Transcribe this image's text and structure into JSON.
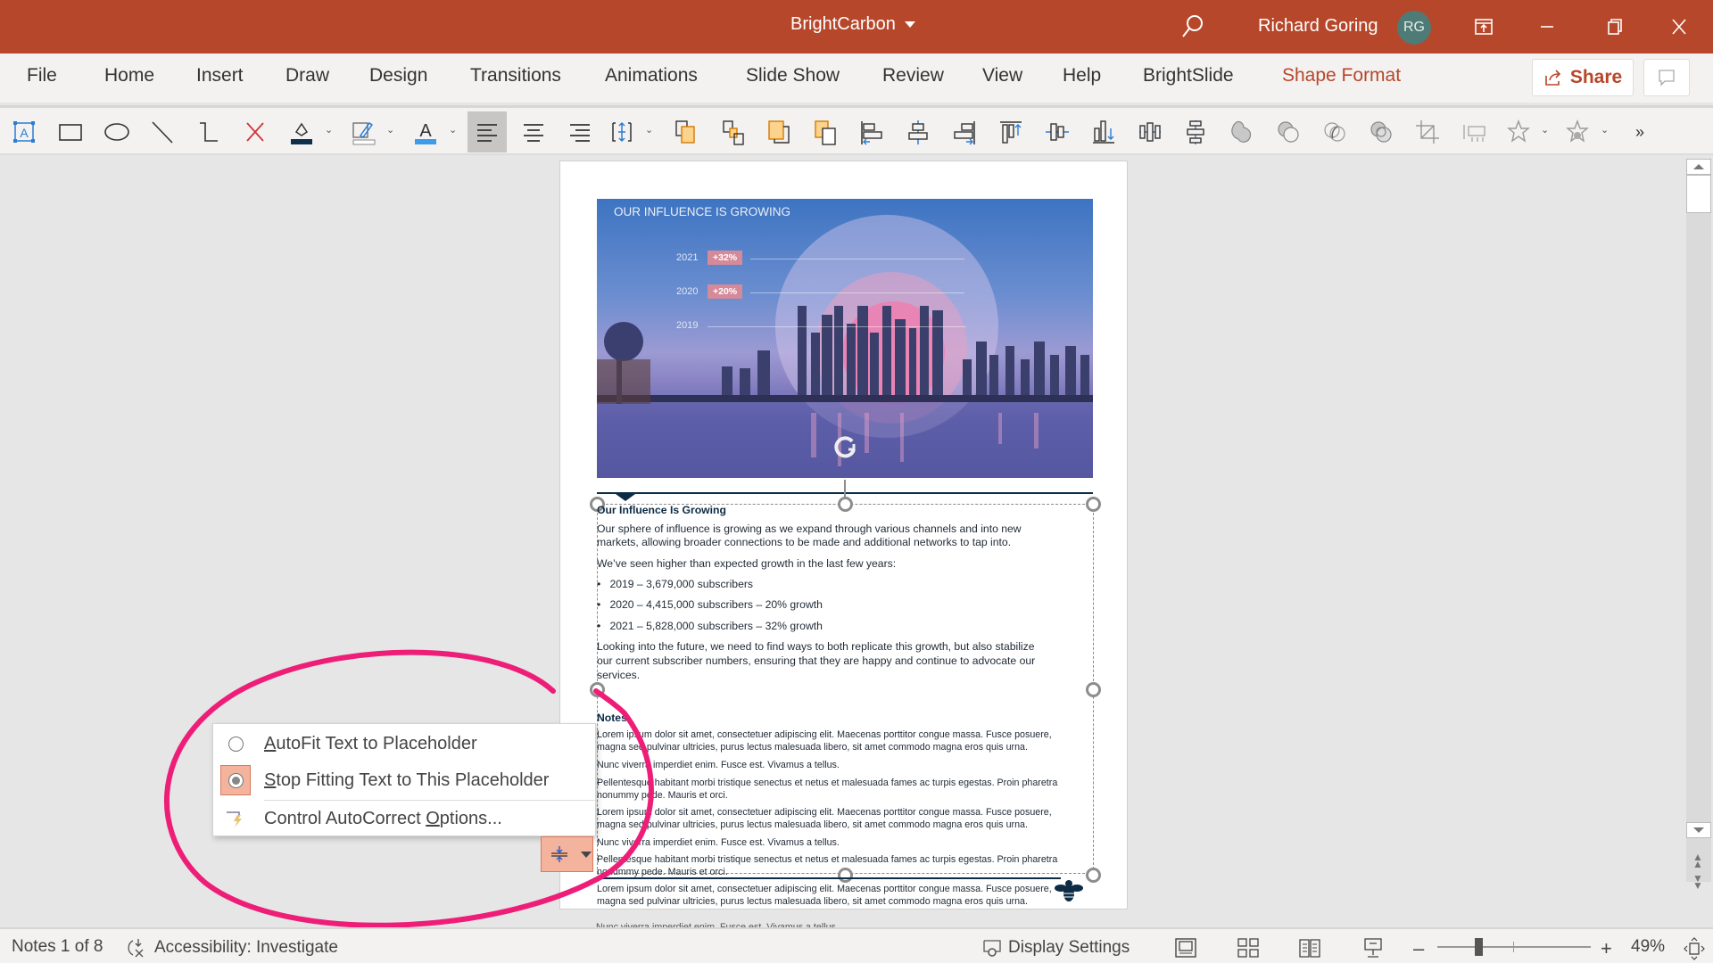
{
  "titlebar": {
    "doc_title": "BrightCarbon",
    "user_name": "Richard Goring",
    "avatar_initials": "RG",
    "brand_color": "#b7472a"
  },
  "ribbon": {
    "tabs": [
      {
        "label": "File"
      },
      {
        "label": "Home"
      },
      {
        "label": "Insert"
      },
      {
        "label": "Draw"
      },
      {
        "label": "Design"
      },
      {
        "label": "Transitions"
      },
      {
        "label": "Animations"
      },
      {
        "label": "Slide Show"
      },
      {
        "label": "Review"
      },
      {
        "label": "View"
      },
      {
        "label": "Help"
      },
      {
        "label": "BrightSlide"
      },
      {
        "label": "Shape Format",
        "active": true
      }
    ],
    "share_label": "Share"
  },
  "toolbar": {
    "icons": [
      "text-box-icon",
      "rectangle-icon",
      "oval-icon",
      "line-icon",
      "elbow-connector-icon",
      "delete-icon",
      "shape-fill-icon",
      "shape-outline-icon",
      "font-color-icon",
      "align-left-icon",
      "align-center-icon",
      "align-right-icon",
      "text-direction-icon",
      "bring-forward-icon",
      "send-backward-icon",
      "bring-to-front-icon",
      "send-to-back-icon",
      "align-objects-left-icon",
      "align-objects-center-icon",
      "align-objects-right-icon",
      "align-top-icon",
      "align-middle-icon",
      "align-bottom-icon",
      "distribute-horizontally-icon",
      "distribute-vertically-icon",
      "merge-union-icon",
      "merge-combine-icon",
      "merge-intersect-icon",
      "merge-fragment-icon",
      "crop-icon",
      "size-icon",
      "add-animation-icon",
      "animation-effects-icon",
      "more-icon"
    ]
  },
  "slide": {
    "hero_title": "OUR INFLUENCE IS GROWING",
    "hero_rows": [
      {
        "year": "2021",
        "badge": "+32%"
      },
      {
        "year": "2020",
        "badge": "+20%"
      },
      {
        "year": "2019",
        "badge": ""
      }
    ],
    "heading": "Our Influence Is Growing",
    "para1_line1": "Our sphere of influence is growing as we expand through various channels and into new",
    "para1_line2": "markets, allowing broader connections to be made and additional networks to tap into.",
    "para2": "We’ve seen higher than expected growth in the last few years:",
    "bullets": [
      "2019 – 3,679,000 subscribers",
      "2020 – 4,415,000 subscribers – 20% growth",
      "2021 – 5,828,000 subscribers – 32% growth"
    ],
    "para3_line1": "Looking into the future, we need to find ways to both replicate this growth, but also stabilize",
    "para3_line2": "our current subscriber numbers, ensuring that they are happy and continue to advocate our",
    "para3_line3": "services.",
    "notes_heading": "Notes",
    "notes": [
      "Lorem ipsum dolor sit amet, consectetuer adipiscing elit. Maecenas porttitor congue massa. Fusce posuere,",
      "magna sed pulvinar ultricies, purus lectus malesuada libero, sit amet commodo magna eros quis urna.",
      "Nunc viverra imperdiet enim. Fusce est. Vivamus a tellus.",
      "Pellentesque habitant morbi tristique senectus et netus et malesuada fames ac turpis egestas. Proin pharetra",
      "nonummy pede. Mauris et orci.",
      "Lorem ipsum dolor sit amet, consectetuer adipiscing elit. Maecenas porttitor congue massa. Fusce posuere,",
      "magna sed pulvinar ultricies, purus lectus malesuada libero, sit amet commodo magna eros quis urna.",
      "Nunc viverra imperdiet enim. Fusce est. Vivamus a tellus.",
      "Pellentesque habitant morbi tristique senectus et netus et malesuada fames ac turpis egestas. Proin pharetra",
      "nonummy pede. Mauris et orci.",
      "Lorem ipsum dolor sit amet, consectetuer adipiscing elit. Maecenas porttitor congue massa. Fusce posuere,",
      "magna sed pulvinar ultricies, purus lectus malesuada libero, sit amet commodo magna eros quis urna.",
      "Nunc viverra imperdiet enim. Fusce est. Vivamus a tellus."
    ]
  },
  "autofit_menu": {
    "items": [
      {
        "label_pre": "",
        "label_u": "A",
        "label_post": "utoFit Text to Placeholder",
        "selected": false
      },
      {
        "label_pre": "",
        "label_u": "S",
        "label_post": "top Fitting Text to This Placeholder",
        "selected": true
      },
      {
        "label_pre": "Control AutoCorrect ",
        "label_u": "O",
        "label_post": "ptions...",
        "selected": false
      }
    ],
    "highlight_color": "#f4b39c",
    "annotation_color": "#ee1e78"
  },
  "status": {
    "notes_position": "Notes 1 of 8",
    "accessibility": "Accessibility: Investigate",
    "display_settings": "Display Settings",
    "zoom_level": "49%",
    "zoom_fraction": 0.27
  }
}
